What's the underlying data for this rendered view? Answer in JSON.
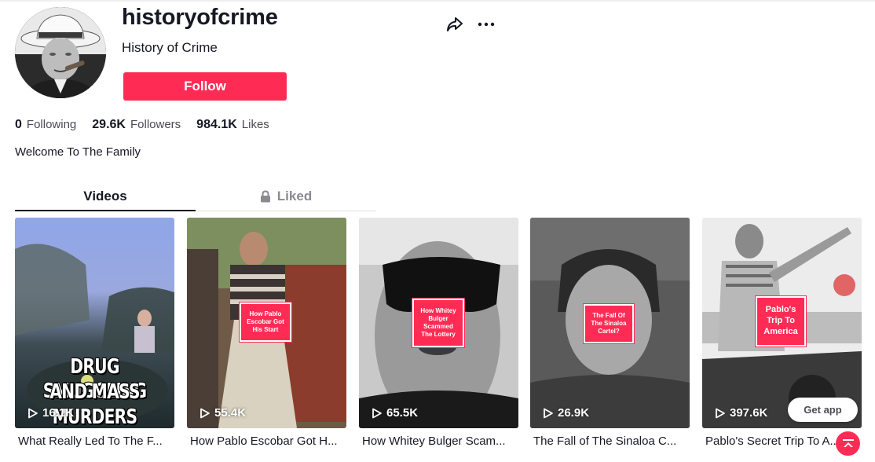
{
  "profile": {
    "username": "historyofcrime",
    "nickname": "History of Crime",
    "follow_label": "Follow",
    "bio": "Welcome To The Family",
    "stats": {
      "following_count": "0",
      "following_label": "Following",
      "followers_count": "29.6K",
      "followers_label": "Followers",
      "likes_count": "984.1K",
      "likes_label": "Likes"
    }
  },
  "tabs": [
    {
      "label": "Videos",
      "active": true
    },
    {
      "label": "Liked",
      "active": false,
      "icon": "lock-icon"
    }
  ],
  "videos": [
    {
      "views": "16.1K",
      "caption": "What Really Led To The F...",
      "overlay_lines": [
        "DRUG SMUGGLING",
        "AND MASS",
        "MURDERS"
      ]
    },
    {
      "views": "55.4K",
      "caption": "How Pablo Escobar Got H...",
      "sticker_lines": [
        "How Pablo",
        "Escobar Got",
        "His Start"
      ]
    },
    {
      "views": "65.5K",
      "caption": "How Whitey Bulger Scam...",
      "sticker_lines": [
        "How Whitey",
        "Bulger",
        "Scammed",
        "The Lottery"
      ]
    },
    {
      "views": "26.9K",
      "caption": "The Fall of The Sinaloa C...",
      "sticker_lines": [
        "The Fall Of",
        "The Sinaloa",
        "Cartel?"
      ]
    },
    {
      "views": "397.6K",
      "caption": "Pablo's Secret Trip To A...",
      "sticker_lines": [
        "Pablo's",
        "Trip To",
        "America"
      ]
    }
  ],
  "floating": {
    "get_app_label": "Get app"
  },
  "colors": {
    "brand": "#fe2c55",
    "text_primary": "#161823",
    "text_secondary": "#4a4b53",
    "tab_inactive": "#8a8b91"
  },
  "icons": [
    "share-icon",
    "more-icon",
    "lock-icon",
    "play-icon",
    "back-to-top-icon"
  ]
}
